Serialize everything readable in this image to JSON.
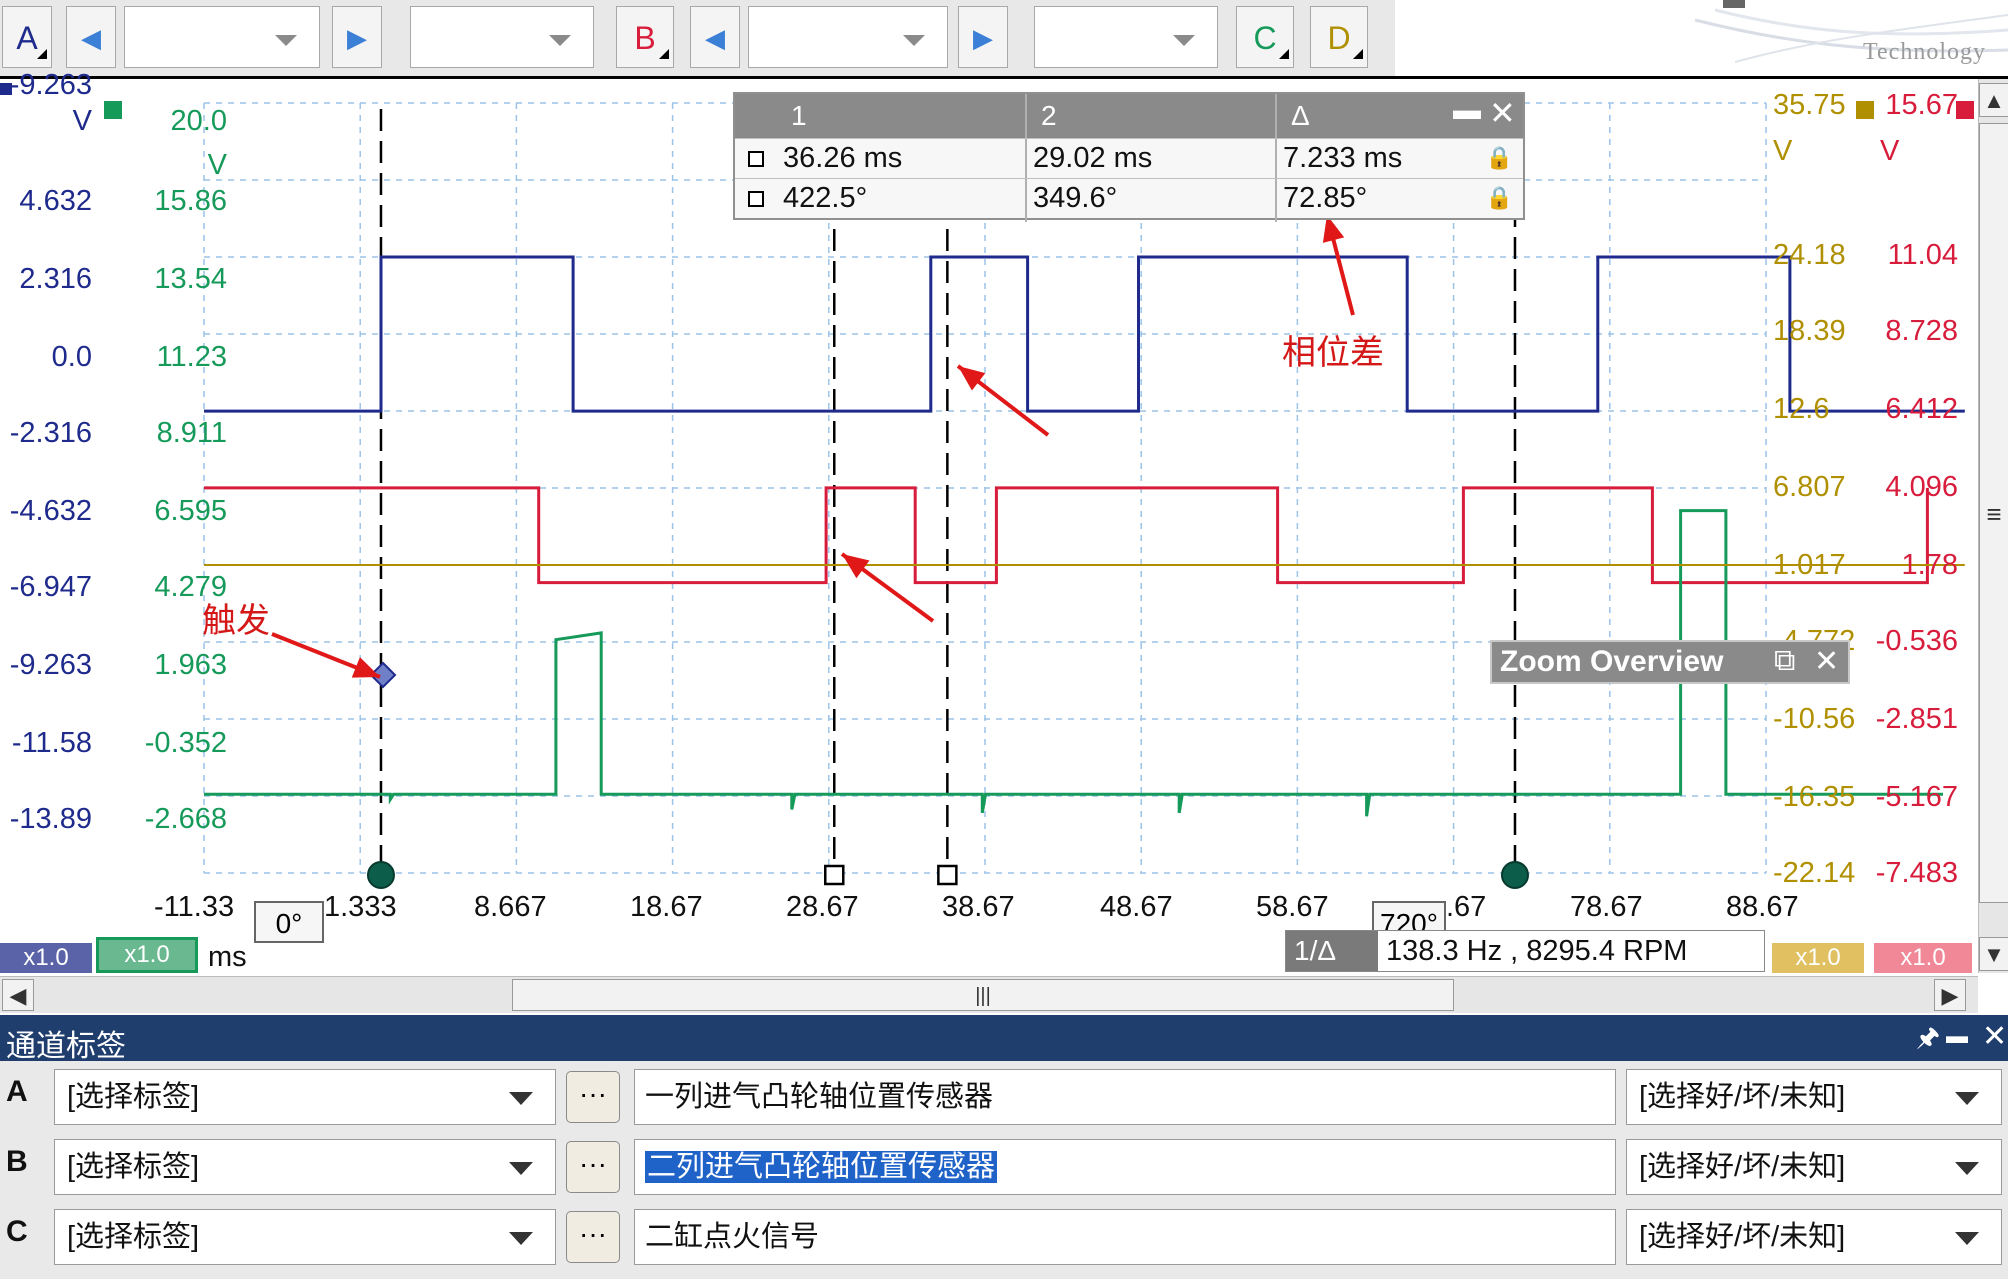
{
  "toolbar": {
    "channel_a": "A",
    "channel_b": "B",
    "channel_c": "C",
    "channel_d": "D",
    "arrow_left": "◀",
    "arrow_right": "▶",
    "logo_text": "Technology"
  },
  "colors": {
    "channel_a": "#1e2a8c",
    "channel_b": "#d81c3c",
    "channel_c": "#159a5a",
    "channel_d": "#b09000",
    "cursor_table_header": "#8a8a8a",
    "panel_title": "#1f3e6e",
    "annotation": "#d41818"
  },
  "axes": {
    "left_a": [
      "-9.263",
      "V",
      "4.632",
      "2.316",
      "0.0",
      "-2.316",
      "-4.632",
      "-6.947",
      "-9.263",
      "-11.58",
      "-13.89"
    ],
    "left_c": [
      "20.0",
      "V",
      "15.86",
      "13.54",
      "11.23",
      "8.911",
      "6.595",
      "4.279",
      "1.963",
      "-0.352",
      "-2.668"
    ],
    "right_d": [
      "35.75",
      "V",
      "24.18",
      "18.39",
      "12.6",
      "6.807",
      "1.017",
      "-4.772",
      "-10.56",
      "-16.35",
      "-22.14"
    ],
    "right_b": [
      "15.67",
      "V",
      "11.04",
      "8.728",
      "6.412",
      "4.096",
      "1.78",
      "-0.536",
      "-2.851",
      "-5.167",
      "-7.483"
    ],
    "x_ticks": [
      "-11.33",
      "1.333",
      "8.667",
      "18.67",
      "28.67",
      "38.67",
      "48.67",
      "58.67",
      ".67",
      "78.67",
      "88.67"
    ],
    "x_unit": "ms",
    "x_chip_a": "x1.0",
    "x_chip_c": "x1.0",
    "x_chip_d": "x1.0",
    "x_chip_b": "x1.0"
  },
  "rulers": {
    "left_label": "0°",
    "right_label": "720°"
  },
  "cursor_table": {
    "headers": [
      "1",
      "2",
      "Δ"
    ],
    "rows": [
      [
        "36.26 ms",
        "29.02 ms",
        "7.233 ms"
      ],
      [
        "422.5°",
        "349.6°",
        "72.85°"
      ]
    ],
    "minimize": "▬",
    "close": "✕",
    "lock": "🔒"
  },
  "zoom_overview": {
    "title": "Zoom Overview",
    "restore": "⧉",
    "close": "✕"
  },
  "frequency": {
    "label": "1/Δ",
    "value": "138.3 Hz , 8295.4 RPM"
  },
  "annotations": {
    "trigger": "触发",
    "phase_diff": "相位差"
  },
  "scroll": {
    "up": "▲",
    "down": "▼",
    "left": "◀",
    "right": "▶",
    "grip": "|||",
    "vgrip": "≡"
  },
  "panel": {
    "title": "通道标签",
    "pin": "🖈",
    "minimize": "▬",
    "close": "✕",
    "rows": [
      {
        "channel": "A",
        "label": "[选择标签]",
        "dots": "···",
        "name": "一列进气凸轮轴位置传感器",
        "status": "[选择好/坏/未知]"
      },
      {
        "channel": "B",
        "label": "[选择标签]",
        "dots": "···",
        "name": "二列进气凸轮轴位置传感器",
        "status": "[选择好/坏/未知]"
      },
      {
        "channel": "C",
        "label": "[选择标签]",
        "dots": "···",
        "name": "二缸点火信号",
        "status": "[选择好/坏/未知]"
      }
    ]
  },
  "chart_data": {
    "type": "line",
    "xlabel": "ms",
    "xlim": [
      -11.33,
      88.67
    ],
    "grid": true,
    "legend": "none",
    "cursors": [
      36.26,
      29.02
    ],
    "rulers": [
      0,
      72.6
    ],
    "series": [
      {
        "name": "A",
        "color": "#1e2a8c",
        "ylim": [
          -13.89,
          9.263
        ],
        "points": [
          [
            -11.33,
            0
          ],
          [
            0,
            0
          ],
          [
            0,
            4.632
          ],
          [
            12.3,
            4.632
          ],
          [
            12.3,
            0
          ],
          [
            35.2,
            0
          ],
          [
            35.2,
            4.632
          ],
          [
            41.4,
            4.632
          ],
          [
            41.4,
            0
          ],
          [
            48.5,
            0
          ],
          [
            48.5,
            4.632
          ],
          [
            65.7,
            4.632
          ],
          [
            65.7,
            0
          ],
          [
            77.9,
            0
          ],
          [
            77.9,
            4.632
          ],
          [
            90.2,
            4.632
          ],
          [
            90.2,
            0
          ],
          [
            101.4,
            0
          ]
        ]
      },
      {
        "name": "B",
        "color": "#d81c3c",
        "ylim": [
          -7.483,
          15.67
        ],
        "points": [
          [
            -11.33,
            4.096
          ],
          [
            10.1,
            4.096
          ],
          [
            10.1,
            1.25
          ],
          [
            28.5,
            1.25
          ],
          [
            28.5,
            4.096
          ],
          [
            34.2,
            4.096
          ],
          [
            34.2,
            1.25
          ],
          [
            39.4,
            1.25
          ],
          [
            39.4,
            4.096
          ],
          [
            57.4,
            4.096
          ],
          [
            57.4,
            1.25
          ],
          [
            69.3,
            1.25
          ],
          [
            69.3,
            4.096
          ],
          [
            81.4,
            4.096
          ],
          [
            81.4,
            1.25
          ],
          [
            99.0,
            1.25
          ],
          [
            99.0,
            4.096
          ]
        ]
      },
      {
        "name": "C",
        "color": "#159a5a",
        "ylim": [
          -2.668,
          20.0
        ],
        "points": [
          [
            -11.33,
            -0.35
          ],
          [
            0.6,
            -0.35
          ],
          [
            0.6,
            -0.5
          ],
          [
            0.8,
            -0.35
          ],
          [
            11.2,
            -0.35
          ],
          [
            11.2,
            4.2
          ],
          [
            14.1,
            4.4
          ],
          [
            14.1,
            -0.35
          ],
          [
            26.3,
            -0.35
          ],
          [
            26.3,
            -0.8
          ],
          [
            26.5,
            -0.35
          ],
          [
            38.5,
            -0.35
          ],
          [
            38.5,
            -0.9
          ],
          [
            38.7,
            -0.35
          ],
          [
            51.1,
            -0.35
          ],
          [
            51.1,
            -0.9
          ],
          [
            51.3,
            -0.35
          ],
          [
            63.1,
            -0.35
          ],
          [
            63.1,
            -1.0
          ],
          [
            63.3,
            -0.35
          ],
          [
            83.2,
            -0.35
          ],
          [
            83.2,
            8.0
          ],
          [
            86.1,
            8.0
          ],
          [
            86.1,
            -0.35
          ],
          [
            100.0,
            -0.35
          ]
        ]
      },
      {
        "name": "D",
        "color": "#b09000",
        "ylim": [
          -22.14,
          35.75
        ],
        "points": [
          [
            -11.33,
            1.017
          ],
          [
            101.4,
            1.017
          ]
        ]
      }
    ]
  }
}
